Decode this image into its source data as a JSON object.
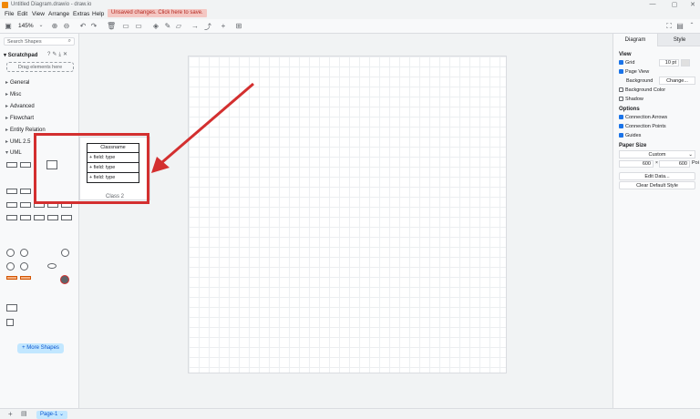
{
  "window": {
    "title": "Untitled Diagram.drawio - draw.io"
  },
  "menu": {
    "items": [
      "File",
      "Edit",
      "View",
      "Arrange",
      "Extras",
      "Help"
    ],
    "unsaved": "Unsaved changes. Click here to save."
  },
  "toolbar": {
    "zoom": "145%"
  },
  "left": {
    "search_placeholder": "Search Shapes",
    "scratchpad": "Scratchpad",
    "drag_hint": "Drag elements here",
    "categories": [
      "General",
      "Misc",
      "Advanced",
      "Flowchart",
      "Entity Relation",
      "UML 2.5",
      "UML"
    ],
    "more_shapes": "+ More Shapes"
  },
  "preview": {
    "class_name": "Classname",
    "fields": [
      "+ field: type",
      "+ field: type",
      "+ field: type"
    ],
    "label": "Class 2"
  },
  "right": {
    "tabs": [
      "Diagram",
      "Style"
    ],
    "view_head": "View",
    "grid": "Grid",
    "grid_size": "10 pt",
    "page_view": "Page View",
    "background": "Background",
    "change": "Change...",
    "bg_color": "Background Color",
    "shadow": "Shadow",
    "options_head": "Options",
    "conn_arrows": "Connection Arrows",
    "conn_points": "Connection Points",
    "guides": "Guides",
    "paper_head": "Paper Size",
    "paper": "Custom",
    "w": "600",
    "h": "600",
    "unit": "Poi",
    "edit_data": "Edit Data...",
    "clear_style": "Clear Default Style"
  },
  "status": {
    "page": "Page-1"
  },
  "colors": {
    "accent": "#1a73e8",
    "annotation": "#d32f2f"
  }
}
